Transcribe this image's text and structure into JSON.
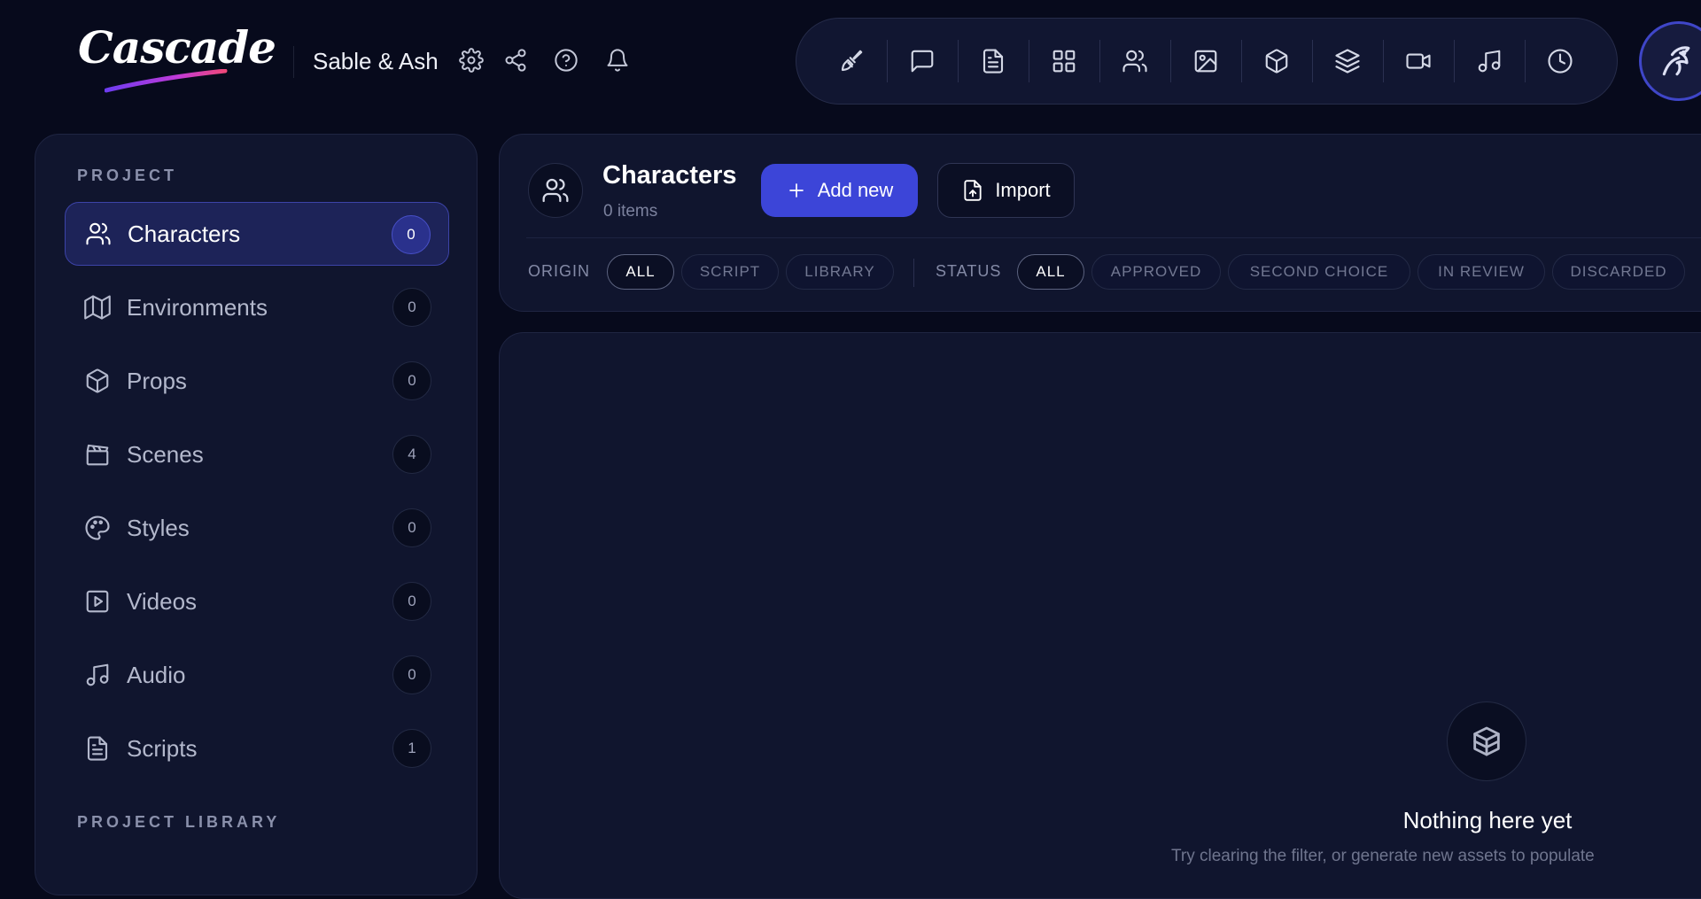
{
  "app": {
    "logo_text": "Cascade",
    "project_name": "Sable & Ash"
  },
  "header_icons": [
    "gear-icon",
    "share-icon",
    "help-icon",
    "bell-icon"
  ],
  "toolbar": {
    "items": [
      "brush-icon",
      "chat-icon",
      "document-icon",
      "grid-icon",
      "users-icon",
      "image-icon",
      "cube-icon",
      "layers-icon",
      "video-icon",
      "music-icon",
      "clock-icon"
    ]
  },
  "sidebar": {
    "section_project": "PROJECT",
    "section_library": "PROJECT LIBRARY",
    "items": [
      {
        "label": "Characters",
        "count": "0",
        "icon": "users-icon",
        "active": true
      },
      {
        "label": "Environments",
        "count": "0",
        "icon": "map-icon"
      },
      {
        "label": "Props",
        "count": "0",
        "icon": "cube-icon"
      },
      {
        "label": "Scenes",
        "count": "4",
        "icon": "clapperboard-icon"
      },
      {
        "label": "Styles",
        "count": "0",
        "icon": "palette-icon"
      },
      {
        "label": "Videos",
        "count": "0",
        "icon": "play-square-icon"
      },
      {
        "label": "Audio",
        "count": "0",
        "icon": "music-icon"
      },
      {
        "label": "Scripts",
        "count": "1",
        "icon": "document-icon"
      }
    ]
  },
  "main": {
    "title": "Characters",
    "count_label": "0 items",
    "add_button": "Add new",
    "import_button": "Import",
    "filters": {
      "origin_label": "ORIGIN",
      "origin_options": [
        "ALL",
        "SCRIPT",
        "LIBRARY"
      ],
      "status_label": "STATUS",
      "status_options": [
        "ALL",
        "APPROVED",
        "SECOND CHOICE",
        "IN REVIEW",
        "DISCARDED"
      ]
    },
    "empty": {
      "title": "Nothing here yet",
      "subtitle": "Try clearing the filter, or generate new assets to populate"
    }
  },
  "colors": {
    "background": "#070a1c",
    "panel": "#10152e",
    "accent": "#3c45d8",
    "active_item": "#1d2358"
  }
}
